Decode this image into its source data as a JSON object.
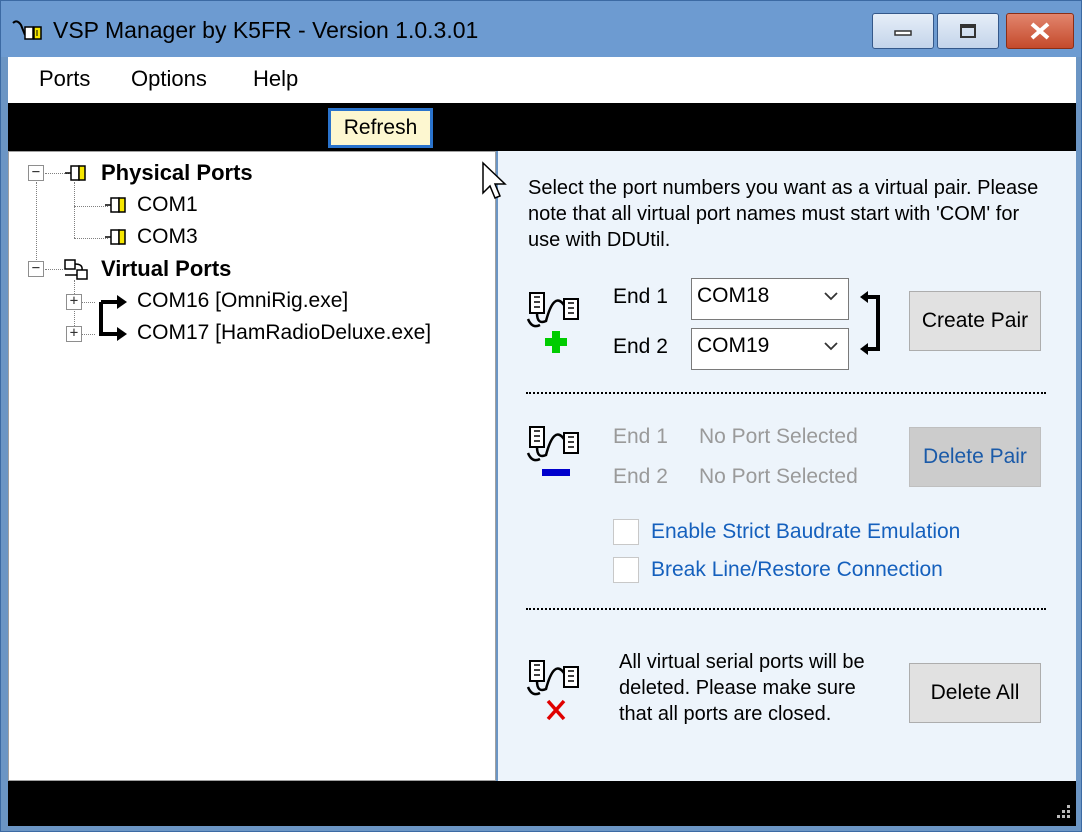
{
  "window": {
    "title": "VSP Manager by K5FR - Version 1.0.3.01"
  },
  "menu": {
    "items": [
      "Ports",
      "Options",
      "Help"
    ]
  },
  "toolbar": {
    "refresh_label": "Refresh"
  },
  "tree": {
    "physical": {
      "label": "Physical Ports",
      "children": [
        "COM1",
        "COM3"
      ]
    },
    "virtual": {
      "label": "Virtual Ports",
      "children": [
        "COM16 [OmniRig.exe]",
        "COM17 [HamRadioDeluxe.exe]"
      ]
    }
  },
  "create_section": {
    "instructions": "Select the port numbers you want as a virtual pair. Please note that all virtual port names must start with 'COM' for use with DDUtil.",
    "end1_label": "End 1",
    "end2_label": "End 2",
    "end1_value": "COM18",
    "end2_value": "COM19",
    "create_button": "Create Pair"
  },
  "delete_section": {
    "end1_label": "End 1",
    "end2_label": "End 2",
    "end1_value": "No Port Selected",
    "end2_value": "No Port Selected",
    "delete_button": "Delete Pair",
    "strict_baud_label": "Enable Strict Baudrate Emulation",
    "strict_baud_checked": false,
    "break_line_label": "Break Line/Restore Connection",
    "break_line_checked": false
  },
  "delete_all_section": {
    "message": "All virtual serial ports will be deleted. Please make sure that all ports are closed.",
    "delete_all_button": "Delete All"
  },
  "colors": {
    "titlebar": "#6d9bd1",
    "panel_bg": "#edf4fb",
    "accent_text": "#1560bd",
    "add_icon": "#00cc00",
    "remove_icon": "#0000cc",
    "delete_icon": "#e00000"
  }
}
